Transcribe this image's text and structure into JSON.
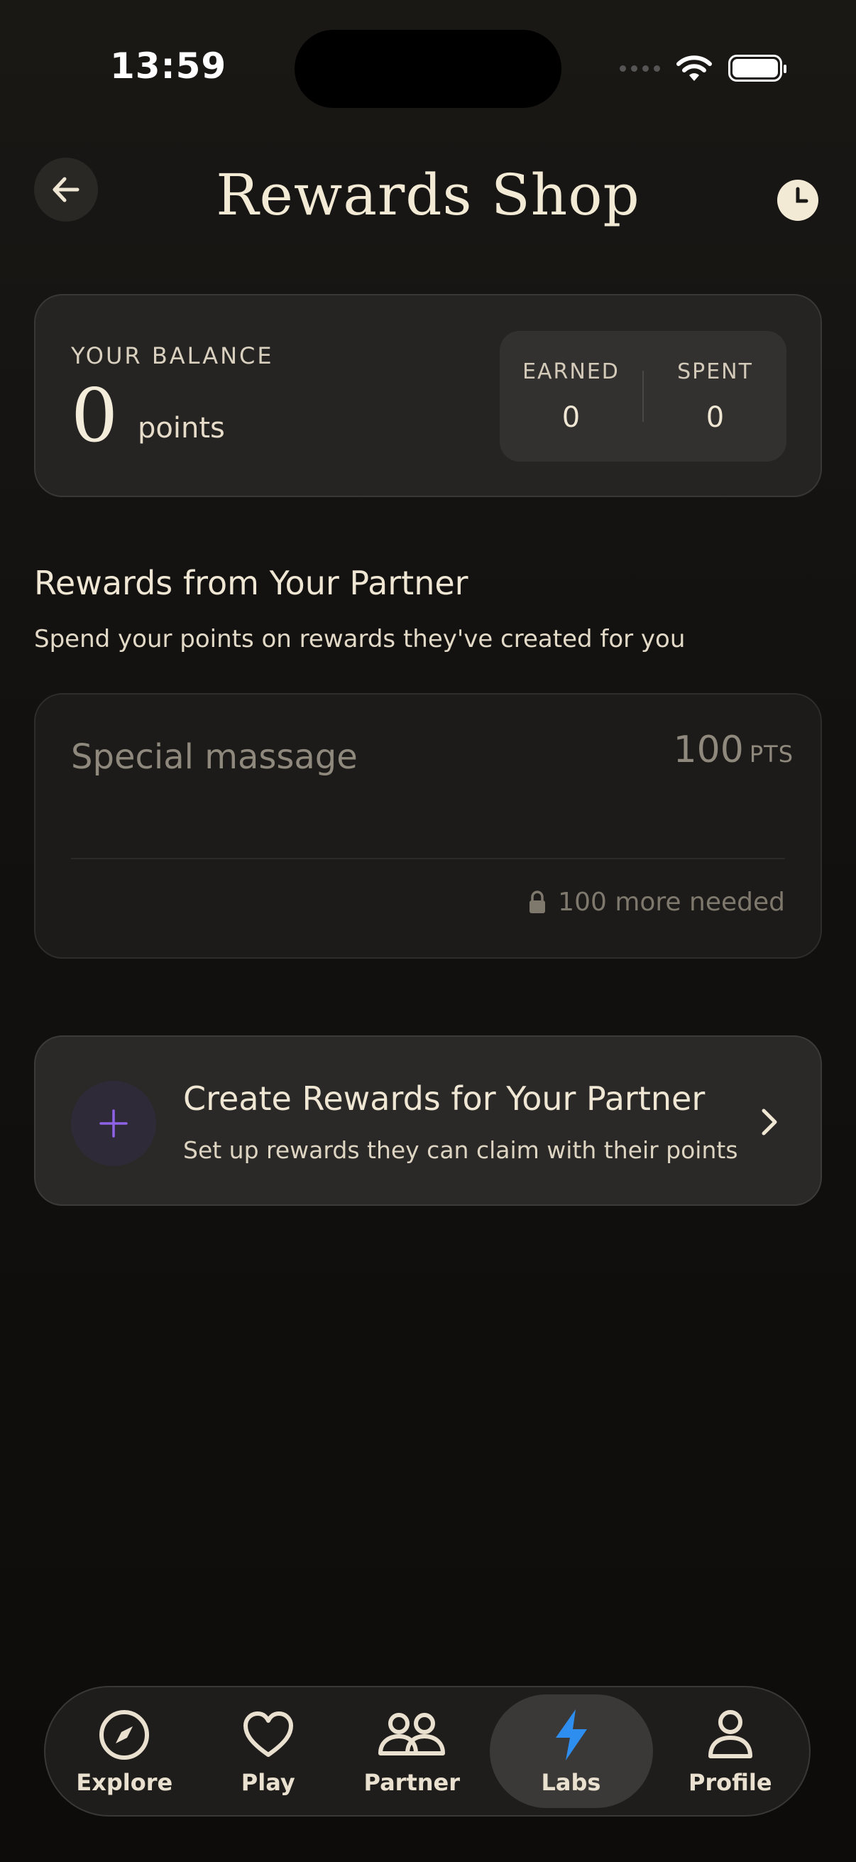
{
  "status_bar": {
    "time": "13:59"
  },
  "header": {
    "title": "Rewards Shop",
    "back_icon": "arrow-left-icon",
    "history_icon": "clock-icon"
  },
  "balance": {
    "label": "YOUR BALANCE",
    "value": "0",
    "unit": "points",
    "earned_label": "EARNED",
    "earned_value": "0",
    "spent_label": "SPENT",
    "spent_value": "0"
  },
  "section": {
    "title": "Rewards from Your Partner",
    "subtitle": "Spend your points on rewards they've created for you"
  },
  "rewards": [
    {
      "name": "Special massage",
      "points": "100",
      "points_unit": "PTS",
      "status": "100 more needed",
      "locked": true
    }
  ],
  "create_card": {
    "title": "Create Rewards for Your Partner",
    "subtitle": "Set up rewards they can claim with their points"
  },
  "tabs": [
    {
      "label": "Explore",
      "icon": "compass-icon",
      "active": false
    },
    {
      "label": "Play",
      "icon": "heart-icon",
      "active": false
    },
    {
      "label": "Partner",
      "icon": "people-icon",
      "active": false
    },
    {
      "label": "Labs",
      "icon": "lightning-icon",
      "active": true
    },
    {
      "label": "Profile",
      "icon": "person-icon",
      "active": false
    }
  ],
  "colors": {
    "accent": "#2e8ef0",
    "plus_accent": "#8f63e8",
    "title": "#f3ead6"
  }
}
